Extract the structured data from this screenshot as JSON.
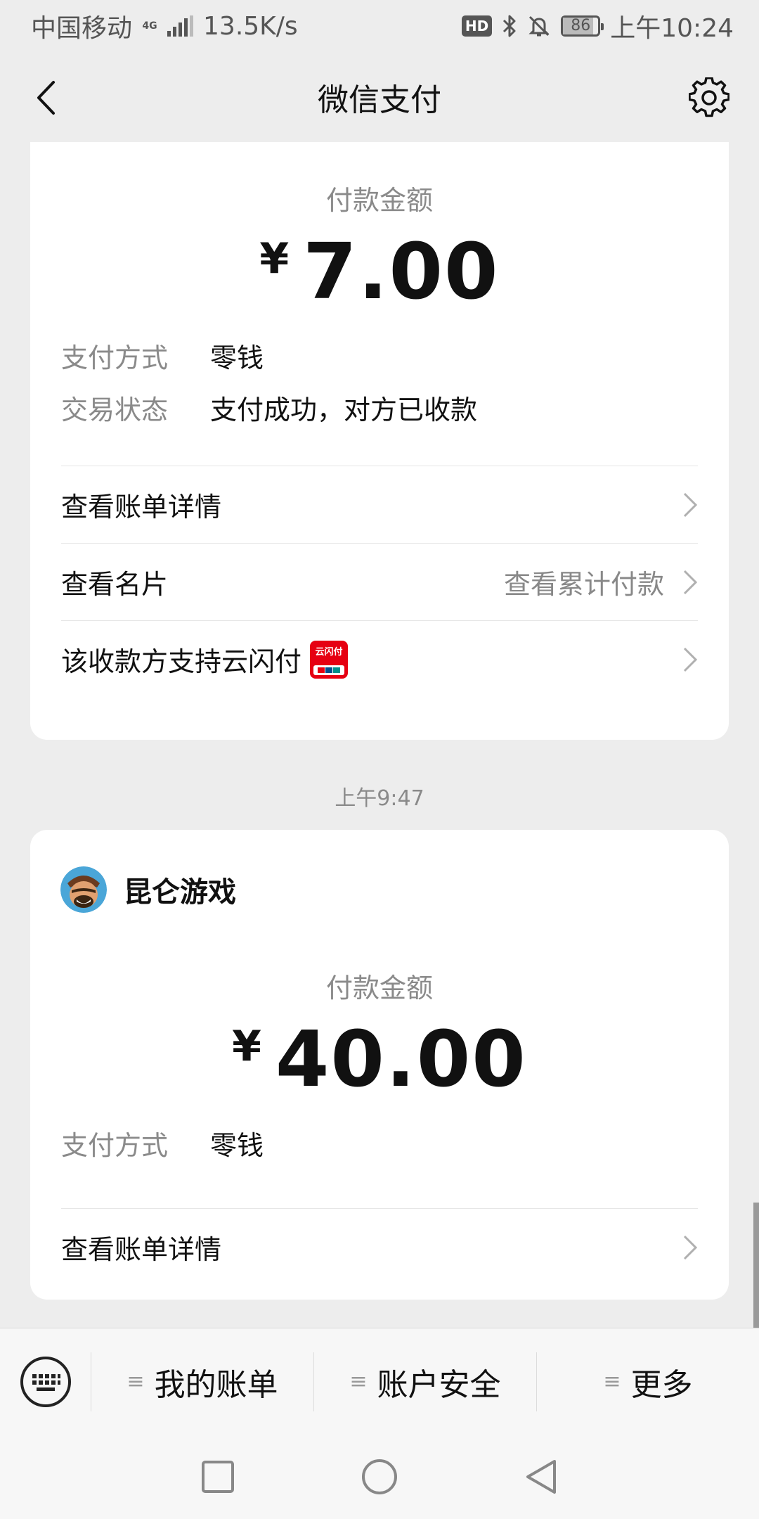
{
  "status_bar": {
    "carrier": "中国移动",
    "network_tag": "4G",
    "speed": "13.5K/s",
    "hd": "HD",
    "battery": "86",
    "time": "上午10:24"
  },
  "header": {
    "title": "微信支付"
  },
  "cards": [
    {
      "amount_label": "付款金额",
      "currency": "¥",
      "amount": "7.00",
      "details": [
        {
          "key": "支付方式",
          "value": "零钱"
        },
        {
          "key": "交易状态",
          "value": "支付成功，对方已收款"
        }
      ],
      "rows": [
        {
          "label": "查看账单详情",
          "extra": ""
        },
        {
          "label": "查看名片",
          "extra": "查看累计付款"
        },
        {
          "label": "该收款方支持云闪付",
          "extra": ""
        }
      ]
    },
    {
      "merchant": "昆仑游戏",
      "amount_label": "付款金额",
      "currency": "¥",
      "amount": "40.00",
      "details": [
        {
          "key": "支付方式",
          "value": "零钱"
        }
      ],
      "rows": [
        {
          "label": "查看账单详情",
          "extra": ""
        }
      ]
    }
  ],
  "timestamp": "上午9:47",
  "unionpay_logo_text": "云闪付",
  "bottom_menu": {
    "items": [
      {
        "label": "我的账单"
      },
      {
        "label": "账户安全"
      },
      {
        "label": "更多"
      }
    ]
  },
  "colors": {
    "background": "#ededed",
    "card": "#ffffff",
    "unionpay_red": "#e60012",
    "secondary_text": "#8a8a8a"
  }
}
